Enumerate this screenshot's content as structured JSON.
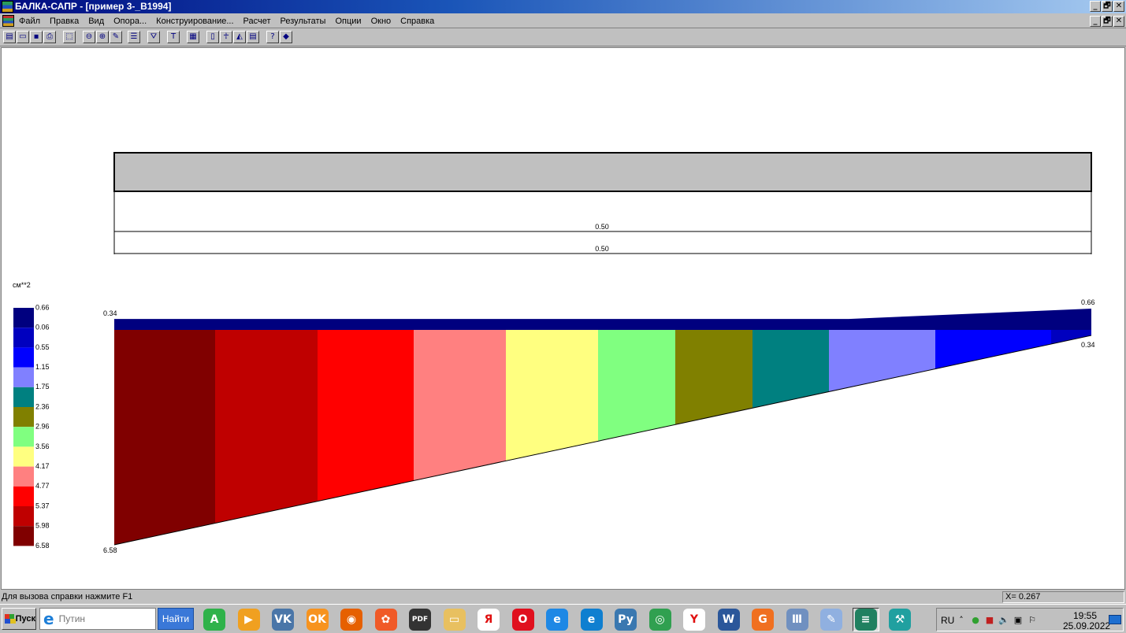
{
  "window": {
    "title": "БАЛКА-САПР - [пример 3-_B1994]",
    "controls": [
      "_",
      "🗗",
      "✕"
    ]
  },
  "menu": {
    "items": [
      "Файл",
      "Правка",
      "Вид",
      "Опора...",
      "Конструирование...",
      "Расчет",
      "Результаты",
      "Опции",
      "Окно",
      "Справка"
    ]
  },
  "toolbar": {
    "buttons": [
      "open-icon",
      "open-folder-icon",
      "save-icon",
      "print-icon",
      "select-rect-icon",
      "zoom-out-icon",
      "zoom-in-icon",
      "pencil-icon",
      "align-icon",
      "filter-icon",
      "section-icon",
      "table-icon",
      "phone-icon",
      "person-icon",
      "chart-icon",
      "report-icon",
      "help-icon",
      "book-icon"
    ]
  },
  "dimensions": {
    "span_upper": "0.50",
    "span_lower": "0.50"
  },
  "legend": {
    "unit": "см**2",
    "entries": [
      {
        "label": "0.66",
        "color": "#00007f"
      },
      {
        "label": "0.06",
        "color": "#0000bf"
      },
      {
        "label": "0.55",
        "color": "#0000ff"
      },
      {
        "label": "1.15",
        "color": "#8080ff"
      },
      {
        "label": "1.75",
        "color": "#008080"
      },
      {
        "label": "2.36",
        "color": "#808000"
      },
      {
        "label": "2.96",
        "color": "#80ff80"
      },
      {
        "label": "3.56",
        "color": "#ffff80"
      },
      {
        "label": "4.17",
        "color": "#ff8080"
      },
      {
        "label": "4.77",
        "color": "#ff0000"
      },
      {
        "label": "5.37",
        "color": "#bf0000"
      },
      {
        "label": "5.98",
        "color": "#800000"
      }
    ],
    "last_label": "6.58"
  },
  "diagram": {
    "top_band": {
      "left_label": "0.34",
      "right_label": "0.66",
      "color": "#00007f",
      "left_value": 0.34,
      "right_value": 0.66
    },
    "bottom": {
      "left_label": "6.58",
      "right_label": "0.34",
      "left_value": 6.58,
      "right_value": 0.34
    },
    "segment_colors": [
      "#800000",
      "#bf0000",
      "#ff0000",
      "#ff8080",
      "#ffff80",
      "#80ff80",
      "#808000",
      "#008080",
      "#8080ff",
      "#0000ff",
      "#0000bf"
    ]
  },
  "status": {
    "help_text": "Для вызова справки нажмите F1",
    "coord_text": "X= 0.267"
  },
  "taskbar": {
    "start_label": "Пуск",
    "search_placeholder": "Путин",
    "search_button": "Найти",
    "apps": [
      {
        "name": "alice-icon",
        "color": "#2fb24a",
        "glyph": "A"
      },
      {
        "name": "player-icon",
        "color": "#f0a020",
        "glyph": "▶"
      },
      {
        "name": "vk-icon",
        "color": "#4a76a8",
        "glyph": "VK"
      },
      {
        "name": "odnoklassniki-icon",
        "color": "#f7931e",
        "glyph": "OK"
      },
      {
        "name": "firefox-icon",
        "color": "#e66000",
        "glyph": "◉"
      },
      {
        "name": "media-icon",
        "color": "#f05a28",
        "glyph": "✿"
      },
      {
        "name": "pdf-tool-icon",
        "color": "#333333",
        "glyph": "PDF"
      },
      {
        "name": "folder-icon",
        "color": "#e8c060",
        "glyph": "▭"
      },
      {
        "name": "yandex-icon",
        "color": "#ffffff",
        "glyph": "Я"
      },
      {
        "name": "opera-icon",
        "color": "#e0101e",
        "glyph": "O"
      },
      {
        "name": "ie-icon",
        "color": "#1e88e5",
        "glyph": "e"
      },
      {
        "name": "edge-icon",
        "color": "#0f7fd0",
        "glyph": "e"
      },
      {
        "name": "python-icon",
        "color": "#3a78b0",
        "glyph": "Py"
      },
      {
        "name": "chrome-icon",
        "color": "#30a050",
        "glyph": "◎"
      },
      {
        "name": "yandex-browser-icon",
        "color": "#ffffff",
        "glyph": "Y"
      },
      {
        "name": "word-icon",
        "color": "#2b579a",
        "glyph": "W"
      },
      {
        "name": "pdf-icon",
        "color": "#f07020",
        "glyph": "G"
      },
      {
        "name": "ionic-icon",
        "color": "#7090c0",
        "glyph": "Ⅲ"
      },
      {
        "name": "paint-icon",
        "color": "#90b0e0",
        "glyph": "✎"
      },
      {
        "name": "balka-icon",
        "color": "#208060",
        "glyph": "≡"
      },
      {
        "name": "cad-icon",
        "color": "#20a0a0",
        "glyph": "⚒"
      }
    ],
    "tray": {
      "lang": "RU",
      "time": "19:55",
      "date": "25.09.2022"
    }
  }
}
